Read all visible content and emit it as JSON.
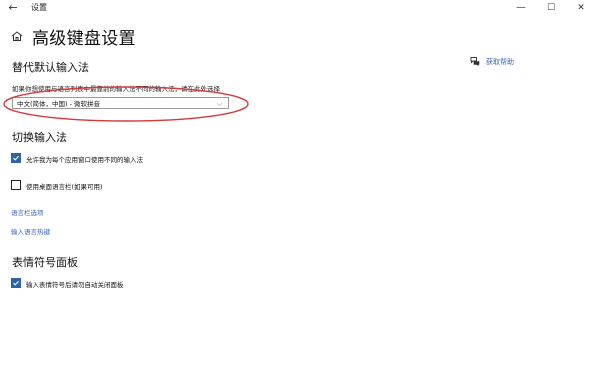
{
  "window": {
    "title": "设置",
    "controls": {
      "minimize": "—",
      "maximize": "☐",
      "close": "✕"
    }
  },
  "header": {
    "title": "高级键盘设置"
  },
  "help": {
    "label": "获取帮助"
  },
  "sections": {
    "override_default": {
      "heading": "替代默认输入法",
      "description": "如果你想使用与语言列表中最靠前的输入法不同的输入法，请在此处选择",
      "select_value": "中文(简体，中国) - 微软拼音"
    },
    "switch_input": {
      "heading": "切换输入法",
      "options": [
        {
          "label": "允许我为每个应用窗口使用不同的输入法",
          "checked": true
        },
        {
          "label": "使用桌面语言栏(如果可用)",
          "checked": false
        }
      ],
      "links": [
        "语言栏选项",
        "输入语言热键"
      ]
    },
    "emoji_panel": {
      "heading": "表情符号面板",
      "options": [
        {
          "label": "输入表情符号后请勿自动关闭面板",
          "checked": true
        }
      ]
    }
  },
  "colors": {
    "accent": "#2e63a8",
    "link": "#3d64c6",
    "annotation": "#d43a3a"
  },
  "icons": {
    "back": "back-arrow-icon",
    "home": "home-icon",
    "help": "chat-bubble-icon"
  }
}
